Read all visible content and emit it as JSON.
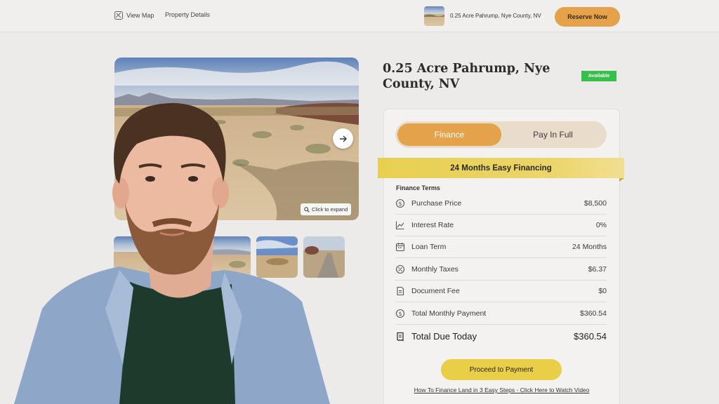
{
  "topbar": {
    "view_map_label": "View Map",
    "property_details_label": "Property Details",
    "listing_title": "0.25 Acre Pahrump, Nye County, NV",
    "reserve_label": "Reserve Now"
  },
  "gallery": {
    "expand_label": "Click to expand",
    "thumbnails": [
      "desert-lot-1",
      "desert-lot-2",
      "desert-lot-3",
      "desert-lot-4",
      "desert-lot-5"
    ]
  },
  "property": {
    "title": "0.25 Acre Pahrump, Nye County, NV",
    "status": "Available"
  },
  "payment_toggle": {
    "finance_label": "Finance",
    "pay_full_label": "Pay In Full",
    "selected": "Finance"
  },
  "ribbon": {
    "text": "24 Months Easy Financing"
  },
  "finance_terms": {
    "label": "Finance Terms",
    "rows": [
      {
        "icon": "dollar-circle-icon",
        "label": "Purchase Price",
        "value": "$8,500"
      },
      {
        "icon": "chart-line-icon",
        "label": "Interest Rate",
        "value": "0%"
      },
      {
        "icon": "calendar-icon",
        "label": "Loan Term",
        "value": "24 Months"
      },
      {
        "icon": "tax-badge-icon",
        "label": "Monthly Taxes",
        "value": "$6.37"
      },
      {
        "icon": "document-icon",
        "label": "Document Fee",
        "value": "$0"
      },
      {
        "icon": "dollar-circle-icon",
        "label": "Total Monthly Payment",
        "value": "$360.54"
      }
    ],
    "total": {
      "icon": "receipt-icon",
      "label": "Total Due Today",
      "value": "$360.54"
    }
  },
  "actions": {
    "proceed_label": "Proceed to Payment",
    "video_link": "How To Finance Land in 3 Easy Steps - Click Here to Watch Video"
  },
  "colors": {
    "accent_orange": "#e4a24a",
    "ribbon_yellow": "#e7cf50",
    "available_green": "#36c04a",
    "background": "#ecebea"
  }
}
